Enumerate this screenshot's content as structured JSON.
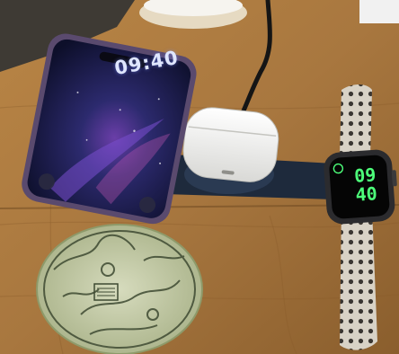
{
  "phone": {
    "lock_time": "09:40"
  },
  "watch": {
    "time_line1": "09",
    "time_line2": "40"
  },
  "colors": {
    "wood": "#a8773f",
    "wood_dark": "#7a5326",
    "phone_frame": "#5a4a6e",
    "screen_night": "#1a1840",
    "airpods_case": "#f2f2f0",
    "charging_pad": "#1e2a3c",
    "watch_digits": "#4dff7a",
    "sport_band": "#d8d2c6",
    "coaster_base": "#c9cfae"
  }
}
